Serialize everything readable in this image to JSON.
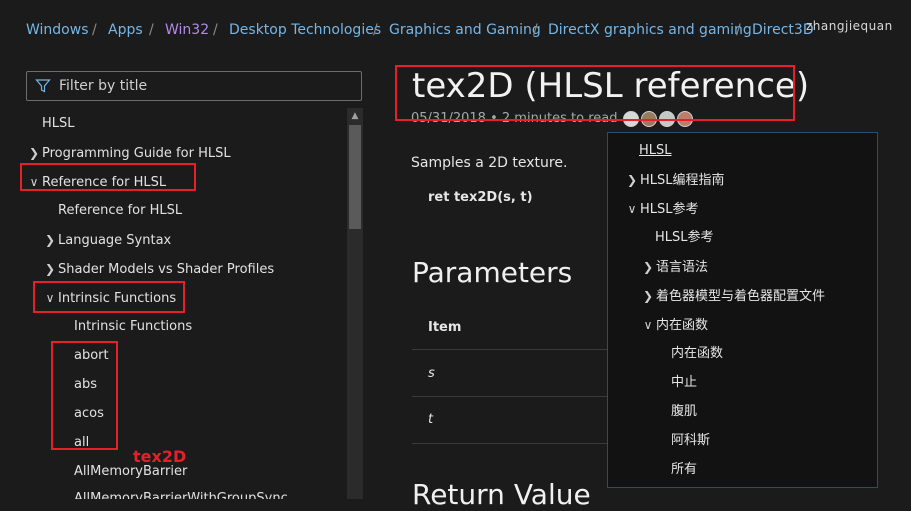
{
  "breadcrumb": {
    "items": [
      "Windows",
      "Apps",
      "Win32",
      "Desktop Technologies",
      "Graphics and Gaming",
      "DirectX graphics and gaming",
      "Direct3D"
    ],
    "sep": "/"
  },
  "watermark": "zhangjiequan",
  "sidebar": {
    "filter_placeholder": "Filter by title",
    "items": [
      {
        "label": "HLSL"
      },
      {
        "label": "Programming Guide for HLSL"
      },
      {
        "label": "Reference for HLSL"
      },
      {
        "label": "Reference for HLSL"
      },
      {
        "label": "Language Syntax"
      },
      {
        "label": "Shader Models vs Shader Profiles"
      },
      {
        "label": "Intrinsic Functions"
      },
      {
        "label": "Intrinsic Functions"
      },
      {
        "label": "abort"
      },
      {
        "label": "abs"
      },
      {
        "label": "acos"
      },
      {
        "label": "all"
      },
      {
        "label": "AllMemoryBarrier"
      },
      {
        "label": "AllMemoryBarrierWithGroupSync"
      }
    ]
  },
  "article": {
    "title": "tex2D (HLSL reference)",
    "date": "05/31/2018",
    "read_time": "2 minutes to read",
    "description": "Samples a 2D texture.",
    "syntax": "ret tex2D(s, t)",
    "params_heading": "Parameters",
    "table_header": "Item",
    "rows": [
      "s",
      "t"
    ],
    "return_heading": "Return Value"
  },
  "annotation_label": "tex2D",
  "popup": {
    "items": [
      {
        "label": "HLSL"
      },
      {
        "label": "HLSL编程指南"
      },
      {
        "label": "HLSL参考"
      },
      {
        "label": "HLSL参考"
      },
      {
        "label": "语言语法"
      },
      {
        "label": "着色器模型与着色器配置文件"
      },
      {
        "label": "内在函数"
      },
      {
        "label": "内在函数"
      },
      {
        "label": "中止"
      },
      {
        "label": "腹肌"
      },
      {
        "label": "阿科斯"
      },
      {
        "label": "所有"
      }
    ]
  },
  "colors": {
    "link": "#75b6e7",
    "active_crumb": "#b18ae8",
    "annotation_red": "#e5202a",
    "background": "#1b1b1b"
  }
}
